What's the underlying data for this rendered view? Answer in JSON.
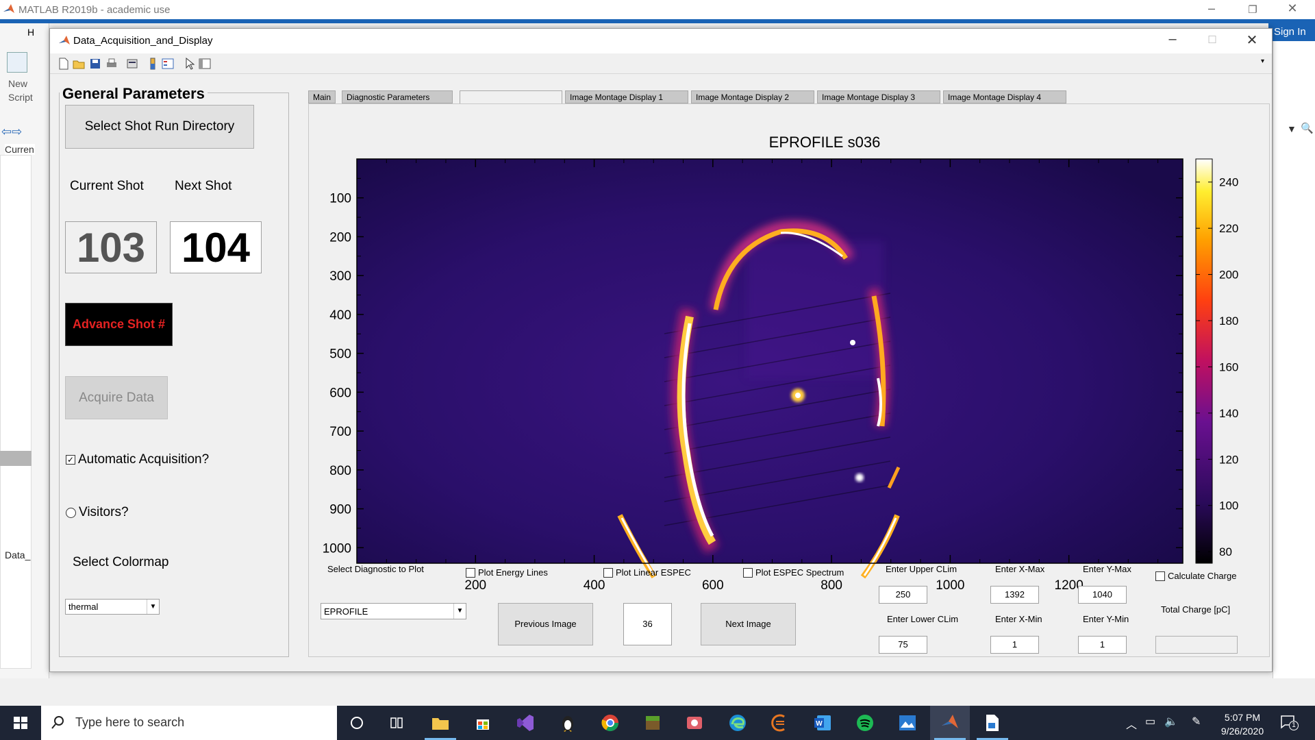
{
  "matlab": {
    "title": "MATLAB R2019b - academic use",
    "home_tab": "H",
    "new_script": "New\nScript",
    "current_folder_label": "Curren",
    "data_label": "Data_",
    "sign_in": "Sign In"
  },
  "figure": {
    "title": "Data_Acquisition_and_Display",
    "general": {
      "title": "General Parameters",
      "select_dir_button": "Select Shot Run Directory",
      "current_shot_label": "Current Shot",
      "next_shot_label": "Next Shot",
      "current_shot": "103",
      "next_shot": "104",
      "advance_button": "Advance Shot #",
      "acquire_button": "Acquire Data",
      "auto_acq_label": "Automatic Acquisition?",
      "auto_acq_checked": true,
      "visitors_label": "Visitors?",
      "visitors_selected": false,
      "colormap_label": "Select Colormap",
      "colormap_value": "thermal"
    },
    "tabs": [
      {
        "label": "Main"
      },
      {
        "label": "Diagnostic Parameters"
      },
      {
        "label": ""
      },
      {
        "label": "Image Montage Display 1"
      },
      {
        "label": "Image Montage Display 2"
      },
      {
        "label": "Image Montage Display 3"
      },
      {
        "label": "Image Montage Display 4"
      }
    ],
    "plot": {
      "title": "EPROFILE s036",
      "y_ticks": [
        "100",
        "200",
        "300",
        "400",
        "500",
        "600",
        "700",
        "800",
        "900",
        "1000"
      ],
      "x_ticks": [
        "200",
        "400",
        "600",
        "800",
        "1000",
        "1200"
      ],
      "colorbar_ticks": [
        "240",
        "220",
        "200",
        "180",
        "160",
        "140",
        "120",
        "100",
        "80"
      ],
      "colormap": "thermal"
    },
    "controls": {
      "diag_label": "Select Diagnostic to Plot",
      "diag_value": "EPROFILE",
      "energy_lines_label": "Plot Energy Lines",
      "linear_espec_label": "Plot Linear ESPEC",
      "espec_spectrum_label": "Plot ESPEC Spectrum",
      "prev_button": "Previous Image",
      "image_number": "36",
      "next_button": "Next Image",
      "upper_clim_label": "Enter Upper CLim",
      "upper_clim": "250",
      "lower_clim_label": "Enter Lower CLim",
      "lower_clim": "75",
      "xmax_label": "Enter X-Max",
      "xmax": "1392",
      "xmin_label": "Enter X-Min",
      "xmin": "1",
      "ymax_label": "Enter Y-Max",
      "ymax": "1040",
      "ymin_label": "Enter Y-Min",
      "ymin": "1",
      "calc_charge_label": "Calculate Charge",
      "total_charge_label": "Total Charge [pC]",
      "total_charge": ""
    }
  },
  "taskbar": {
    "search_placeholder": "Type here to search",
    "time": "5:07 PM",
    "date": "9/26/2020",
    "notification_count": "1"
  }
}
